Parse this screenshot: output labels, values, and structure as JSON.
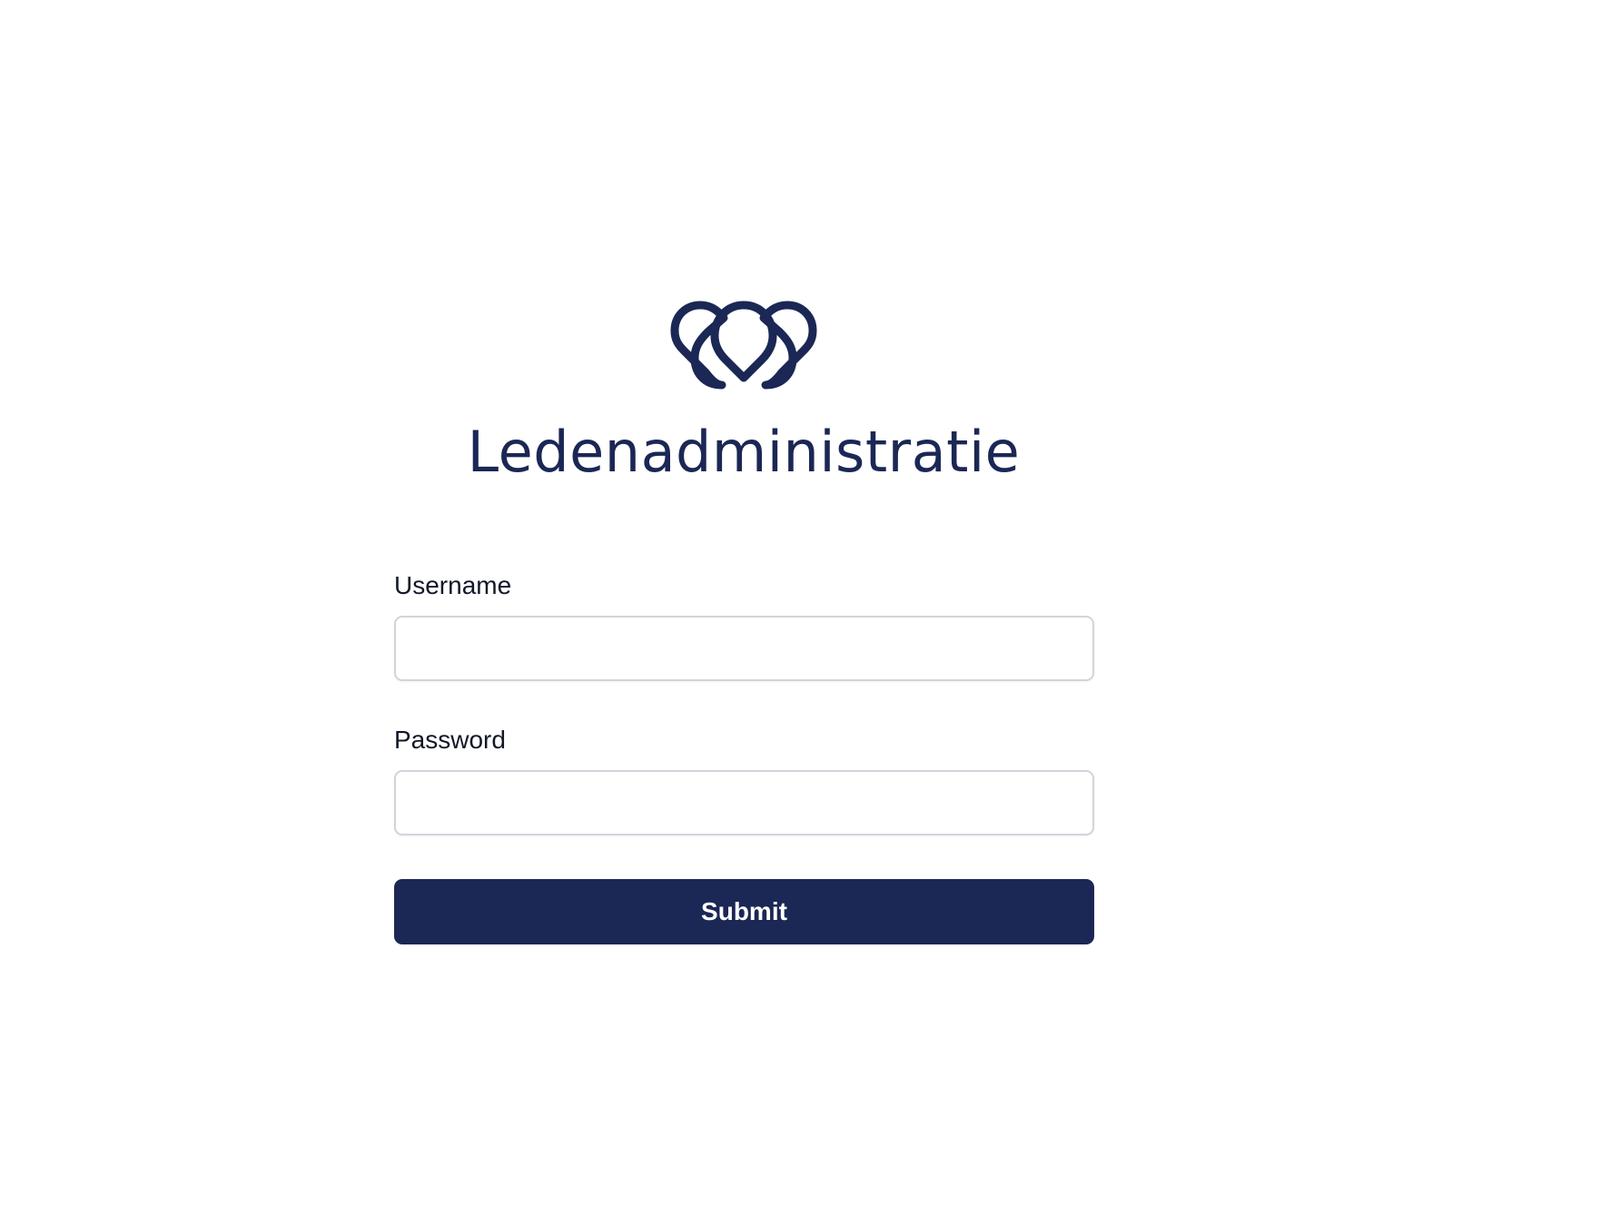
{
  "brand": {
    "logo_icon": "interlocking-loops-logo-icon",
    "title": "Ledenadministratie",
    "color": "#1b2754"
  },
  "form": {
    "username": {
      "label": "Username",
      "value": "",
      "placeholder": ""
    },
    "password": {
      "label": "Password",
      "value": "",
      "placeholder": ""
    },
    "submit_label": "Submit"
  },
  "colors": {
    "primary": "#1b2754",
    "input_border": "#d1d5db",
    "background": "#ffffff"
  }
}
